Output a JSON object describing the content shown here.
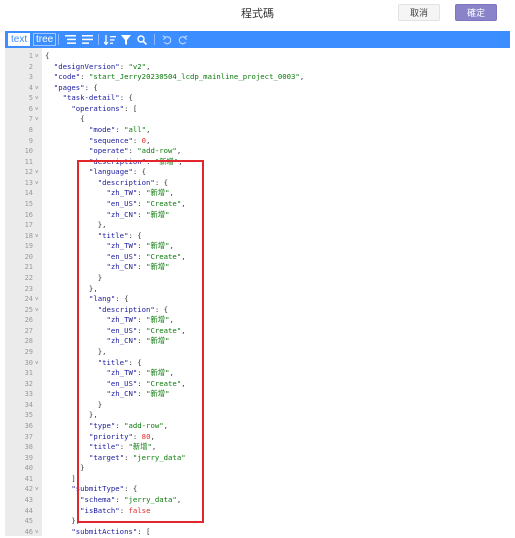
{
  "header": {
    "title": "程式碼",
    "cancel_label": "取消",
    "confirm_label": "確定"
  },
  "toolbar": {
    "mode_text": "text",
    "mode_tree": "tree",
    "icons": [
      "format-icon",
      "compact-icon",
      "sort-icon",
      "filter-icon",
      "search-icon",
      "undo-icon",
      "redo-icon"
    ]
  },
  "colors": {
    "accent": "#3c8dff",
    "confirm": "#8a83c9",
    "highlight": "#e3262e",
    "key": "#1a1a9e",
    "string": "#0b7a0b",
    "number": "#e02b2b"
  },
  "editor": {
    "lines": [
      [
        [
          "p",
          "{"
        ]
      ],
      [
        [
          "p",
          "  "
        ],
        [
          "k",
          "\"designVersion\""
        ],
        [
          "p",
          ": "
        ],
        [
          "s",
          "\"v2\""
        ],
        [
          "p",
          ","
        ]
      ],
      [
        [
          "p",
          "  "
        ],
        [
          "k",
          "\"code\""
        ],
        [
          "p",
          ": "
        ],
        [
          "s",
          "\"start_Jerry20230504_lcdp_mainline_project_0003\""
        ],
        [
          "p",
          ","
        ]
      ],
      [
        [
          "p",
          "  "
        ],
        [
          "k",
          "\"pages\""
        ],
        [
          "p",
          ": {"
        ]
      ],
      [
        [
          "p",
          "    "
        ],
        [
          "k",
          "\"task-detail\""
        ],
        [
          "p",
          ": {"
        ]
      ],
      [
        [
          "p",
          "      "
        ],
        [
          "k",
          "\"operations\""
        ],
        [
          "p",
          ": ["
        ]
      ],
      [
        [
          "p",
          "        {"
        ]
      ],
      [
        [
          "p",
          "          "
        ],
        [
          "k",
          "\"mode\""
        ],
        [
          "p",
          ": "
        ],
        [
          "s",
          "\"all\""
        ],
        [
          "p",
          ","
        ]
      ],
      [
        [
          "p",
          "          "
        ],
        [
          "k",
          "\"sequence\""
        ],
        [
          "p",
          ": "
        ],
        [
          "n",
          "0"
        ],
        [
          "p",
          ","
        ]
      ],
      [
        [
          "p",
          "          "
        ],
        [
          "k",
          "\"operate\""
        ],
        [
          "p",
          ": "
        ],
        [
          "s",
          "\"add-row\""
        ],
        [
          "p",
          ","
        ]
      ],
      [
        [
          "p",
          "          "
        ],
        [
          "k",
          "\"description\""
        ],
        [
          "p",
          ": "
        ],
        [
          "s",
          "\"新增\""
        ],
        [
          "p",
          ","
        ]
      ],
      [
        [
          "p",
          "          "
        ],
        [
          "k",
          "\"language\""
        ],
        [
          "p",
          ": {"
        ]
      ],
      [
        [
          "p",
          "            "
        ],
        [
          "k",
          "\"description\""
        ],
        [
          "p",
          ": {"
        ]
      ],
      [
        [
          "p",
          "              "
        ],
        [
          "k",
          "\"zh_TW\""
        ],
        [
          "p",
          ": "
        ],
        [
          "s",
          "\"新增\""
        ],
        [
          "p",
          ","
        ]
      ],
      [
        [
          "p",
          "              "
        ],
        [
          "k",
          "\"en_US\""
        ],
        [
          "p",
          ": "
        ],
        [
          "s",
          "\"Create\""
        ],
        [
          "p",
          ","
        ]
      ],
      [
        [
          "p",
          "              "
        ],
        [
          "k",
          "\"zh_CN\""
        ],
        [
          "p",
          ": "
        ],
        [
          "s",
          "\"新增\""
        ]
      ],
      [
        [
          "p",
          "            },"
        ]
      ],
      [
        [
          "p",
          "            "
        ],
        [
          "k",
          "\"title\""
        ],
        [
          "p",
          ": {"
        ]
      ],
      [
        [
          "p",
          "              "
        ],
        [
          "k",
          "\"zh_TW\""
        ],
        [
          "p",
          ": "
        ],
        [
          "s",
          "\"新增\""
        ],
        [
          "p",
          ","
        ]
      ],
      [
        [
          "p",
          "              "
        ],
        [
          "k",
          "\"en_US\""
        ],
        [
          "p",
          ": "
        ],
        [
          "s",
          "\"Create\""
        ],
        [
          "p",
          ","
        ]
      ],
      [
        [
          "p",
          "              "
        ],
        [
          "k",
          "\"zh_CN\""
        ],
        [
          "p",
          ": "
        ],
        [
          "s",
          "\"新增\""
        ]
      ],
      [
        [
          "p",
          "            }"
        ]
      ],
      [
        [
          "p",
          "          },"
        ]
      ],
      [
        [
          "p",
          "          "
        ],
        [
          "k",
          "\"lang\""
        ],
        [
          "p",
          ": {"
        ]
      ],
      [
        [
          "p",
          "            "
        ],
        [
          "k",
          "\"description\""
        ],
        [
          "p",
          ": {"
        ]
      ],
      [
        [
          "p",
          "              "
        ],
        [
          "k",
          "\"zh_TW\""
        ],
        [
          "p",
          ": "
        ],
        [
          "s",
          "\"新增\""
        ],
        [
          "p",
          ","
        ]
      ],
      [
        [
          "p",
          "              "
        ],
        [
          "k",
          "\"en_US\""
        ],
        [
          "p",
          ": "
        ],
        [
          "s",
          "\"Create\""
        ],
        [
          "p",
          ","
        ]
      ],
      [
        [
          "p",
          "              "
        ],
        [
          "k",
          "\"zh_CN\""
        ],
        [
          "p",
          ": "
        ],
        [
          "s",
          "\"新增\""
        ]
      ],
      [
        [
          "p",
          "            },"
        ]
      ],
      [
        [
          "p",
          "            "
        ],
        [
          "k",
          "\"title\""
        ],
        [
          "p",
          ": {"
        ]
      ],
      [
        [
          "p",
          "              "
        ],
        [
          "k",
          "\"zh_TW\""
        ],
        [
          "p",
          ": "
        ],
        [
          "s",
          "\"新增\""
        ],
        [
          "p",
          ","
        ]
      ],
      [
        [
          "p",
          "              "
        ],
        [
          "k",
          "\"en_US\""
        ],
        [
          "p",
          ": "
        ],
        [
          "s",
          "\"Create\""
        ],
        [
          "p",
          ","
        ]
      ],
      [
        [
          "p",
          "              "
        ],
        [
          "k",
          "\"zh_CN\""
        ],
        [
          "p",
          ": "
        ],
        [
          "s",
          "\"新增\""
        ]
      ],
      [
        [
          "p",
          "            }"
        ]
      ],
      [
        [
          "p",
          "          },"
        ]
      ],
      [
        [
          "p",
          "          "
        ],
        [
          "k",
          "\"type\""
        ],
        [
          "p",
          ": "
        ],
        [
          "s",
          "\"add-row\""
        ],
        [
          "p",
          ","
        ]
      ],
      [
        [
          "p",
          "          "
        ],
        [
          "k",
          "\"priority\""
        ],
        [
          "p",
          ": "
        ],
        [
          "n",
          "80"
        ],
        [
          "p",
          ","
        ]
      ],
      [
        [
          "p",
          "          "
        ],
        [
          "k",
          "\"title\""
        ],
        [
          "p",
          ": "
        ],
        [
          "s",
          "\"新增\""
        ],
        [
          "p",
          ","
        ]
      ],
      [
        [
          "p",
          "          "
        ],
        [
          "k",
          "\"target\""
        ],
        [
          "p",
          ": "
        ],
        [
          "s",
          "\"jerry_data\""
        ]
      ],
      [
        [
          "p",
          "        }"
        ]
      ],
      [
        [
          "p",
          "      ],"
        ]
      ],
      [
        [
          "p",
          "      "
        ],
        [
          "k",
          "\"submitType\""
        ],
        [
          "p",
          ": {"
        ]
      ],
      [
        [
          "p",
          "        "
        ],
        [
          "k",
          "\"schema\""
        ],
        [
          "p",
          ": "
        ],
        [
          "s",
          "\"jerry_data\""
        ],
        [
          "p",
          ","
        ]
      ],
      [
        [
          "p",
          "        "
        ],
        [
          "k",
          "\"isBatch\""
        ],
        [
          "p",
          ": "
        ],
        [
          "b",
          "false"
        ]
      ],
      [
        [
          "p",
          "      },"
        ]
      ],
      [
        [
          "p",
          "      "
        ],
        [
          "k",
          "\"submitActions\""
        ],
        [
          "p",
          ": ["
        ]
      ]
    ],
    "foldable_lines": [
      1,
      4,
      5,
      6,
      7,
      12,
      13,
      18,
      24,
      25,
      30,
      42,
      46
    ]
  }
}
